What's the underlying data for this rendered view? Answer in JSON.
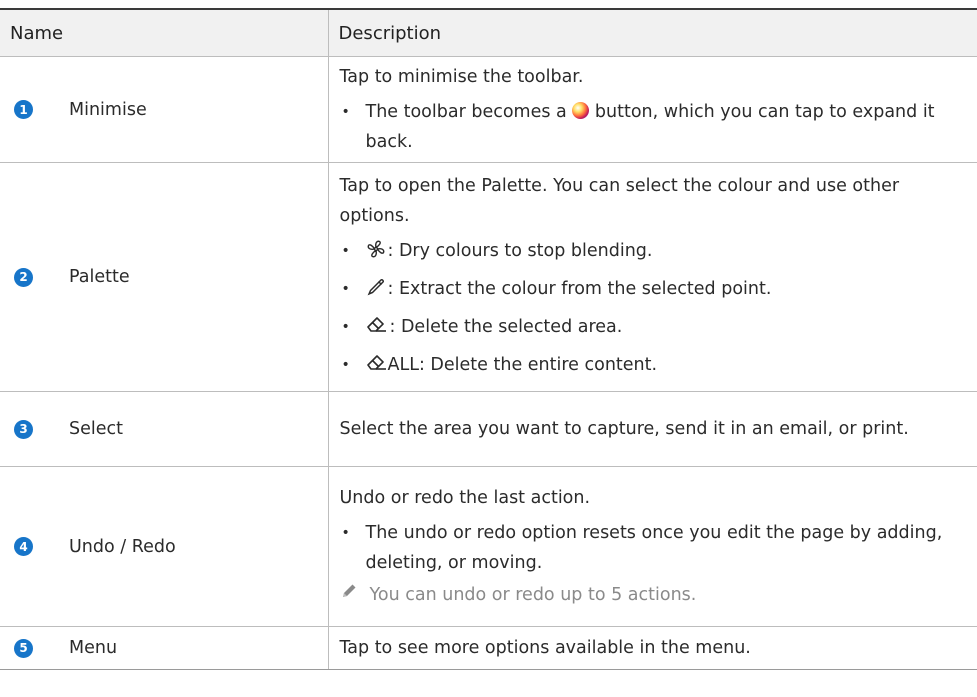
{
  "header": {
    "name": "Name",
    "description": "Description"
  },
  "rows": [
    {
      "number": "1",
      "name": "Minimise",
      "desc": "Tap to minimise the toolbar.",
      "bullets": [
        {
          "before": "The toolbar becomes a",
          "after": "button, which you can tap to expand it back."
        }
      ]
    },
    {
      "number": "2",
      "name": "Palette",
      "desc": "Tap to open the Palette. You can select the colour and use other options.",
      "bullets": [
        {
          "icon": "fan-dry-icon",
          "text": ": Dry colours to stop blending."
        },
        {
          "icon": "eyedropper-icon",
          "text": ": Extract the colour from the selected point."
        },
        {
          "icon": "eraser-icon",
          "text": ": Delete the selected area."
        },
        {
          "icon": "eraser-all-icon",
          "text": "ALL: Delete the entire content."
        }
      ]
    },
    {
      "number": "3",
      "name": "Select",
      "desc": "Select the area you want to capture, send it in an email, or print."
    },
    {
      "number": "4",
      "name": "Undo / Redo",
      "desc": "Undo or redo the last action.",
      "bullets": [
        {
          "text": "The undo or redo option resets once you edit the page by adding, deleting, or moving."
        }
      ],
      "note": {
        "icon": "pencil-note-icon",
        "text": "You can undo or redo up to 5 actions."
      }
    },
    {
      "number": "5",
      "name": "Menu",
      "desc": "Tap to see more options available in the menu."
    }
  ],
  "bullet_char": "•",
  "colors": {
    "number_badge": "#1775c9",
    "header_bg": "#f1f1f1",
    "note_text": "#8a8a8a"
  }
}
